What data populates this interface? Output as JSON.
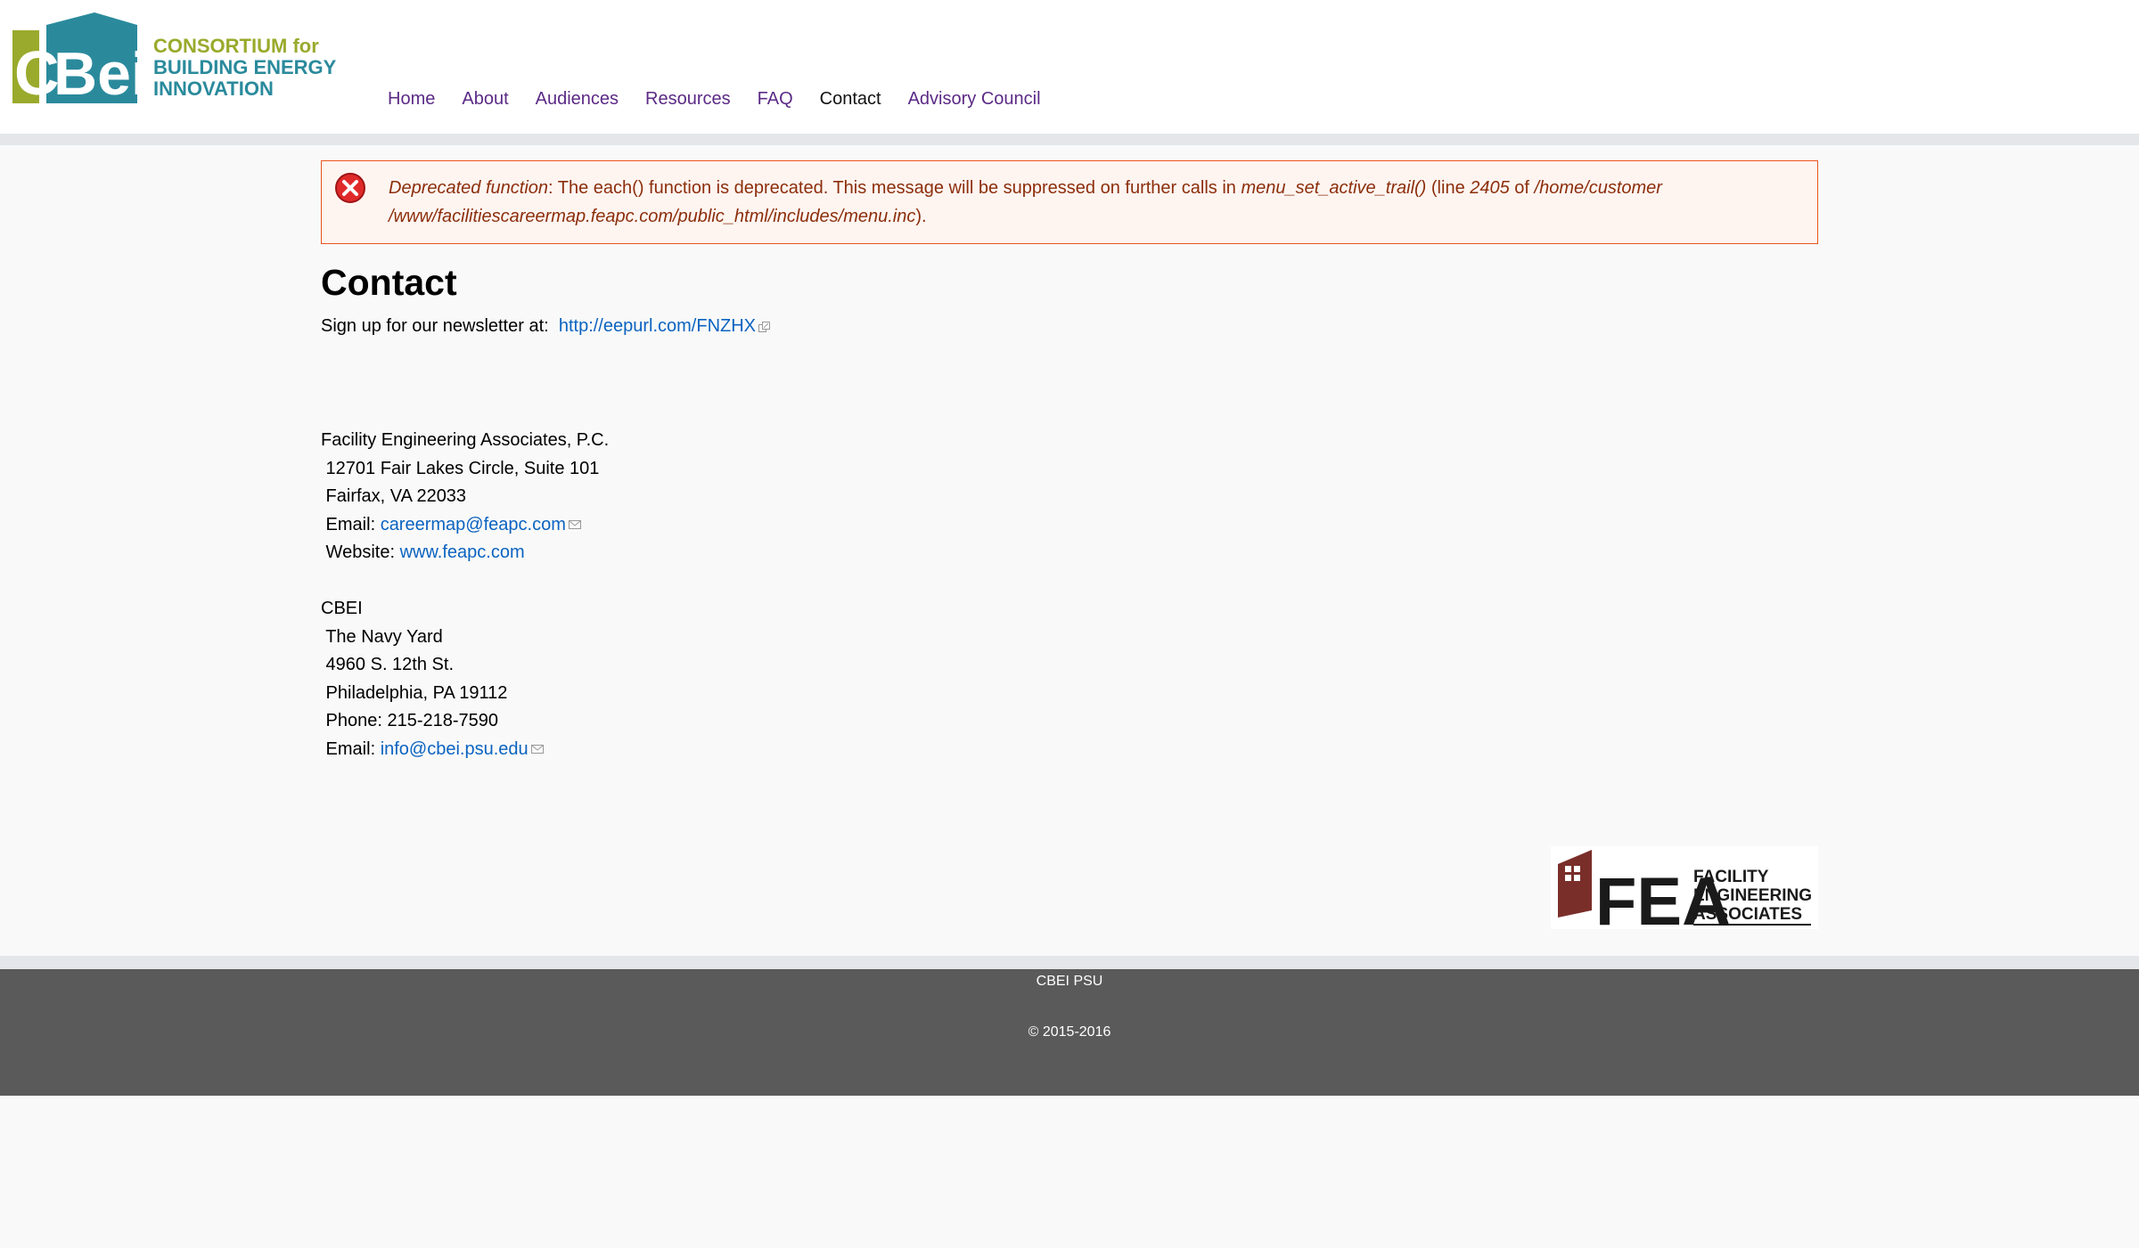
{
  "header": {
    "logo_mark": "CBEI",
    "logo_lines": [
      "CONSORTIUM for",
      "BUILDING ENERGY",
      "INNOVATION"
    ],
    "nav": [
      {
        "label": "Home",
        "active": false
      },
      {
        "label": "About",
        "active": false
      },
      {
        "label": "Audiences",
        "active": false
      },
      {
        "label": "Resources",
        "active": false
      },
      {
        "label": "FAQ",
        "active": false
      },
      {
        "label": "Contact",
        "active": true
      },
      {
        "label": "Advisory Council",
        "active": false
      }
    ]
  },
  "message": {
    "type_label": "Deprecated function",
    "text_1": ": The each() function is deprecated. This message will be suppressed on further calls in ",
    "function": "menu_set_active_trail()",
    "text_2": " (line ",
    "line": "2405",
    "text_3": " of ",
    "path_1": "/home/customer",
    "path_2": "/www/facilitiescareermap.feapc.com/public_html/includes/menu.inc",
    "text_4": ")."
  },
  "page_title": "Contact",
  "newsletter": {
    "label": "Sign up for our newsletter at:",
    "link": "http://eepurl.com/FNZHX"
  },
  "fea": {
    "name": "Facility Engineering Associates, P.C.",
    "street": " 12701 Fair Lakes Circle, Suite 101",
    "city": " Fairfax, VA 22033",
    "email_label": " Email: ",
    "email": "careermap@feapc.com",
    "website_label": " Website: ",
    "website": "www.feapc.com"
  },
  "cbei": {
    "name": "CBEI",
    "line1": " The Navy Yard",
    "line2": " 4960 S. 12th St.",
    "line3": " Philadelphia, PA 19112",
    "phone": " Phone: 215-218-7590",
    "email_label": " Email: ",
    "email": "info@cbei.psu.edu"
  },
  "fea_logo": {
    "mark": "FEA",
    "lines": [
      "FACILITY",
      "ENGINEERING",
      "ASSOCIATES"
    ]
  },
  "footer": {
    "line1": "CBEI PSU",
    "line2": "© 2015-2016"
  },
  "colors": {
    "nav_link": "#5b2a86",
    "link": "#0b63c0",
    "error_text": "#8c2e0b",
    "error_border": "#ed541d",
    "footer_bg": "#5a5a5a",
    "logo_green": "#9aaa2c",
    "logo_teal": "#2a8a9c"
  }
}
